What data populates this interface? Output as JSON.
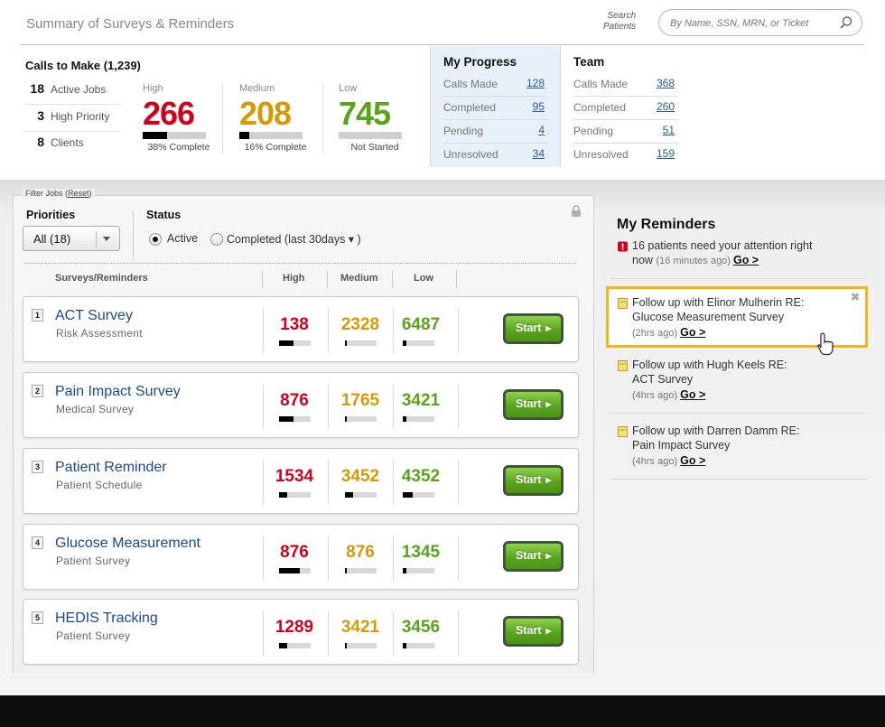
{
  "header": {
    "title": "Summary of Surveys & Reminders",
    "search_label_line1": "Search",
    "search_label_line2": "Patients",
    "search_placeholder": "By Name, SSN, MRN, or Ticket"
  },
  "calls": {
    "title": "Calls to Make (1,239)",
    "stats": [
      {
        "num": "18",
        "label": "Active Jobs"
      },
      {
        "num": "3",
        "label": "High Priority"
      },
      {
        "num": "8",
        "label": "Clients"
      }
    ],
    "high": {
      "label": "High",
      "value": "266",
      "progress": 0.38,
      "caption": "38% Complete"
    },
    "medium": {
      "label": "Medium",
      "value": "208",
      "progress": 0.16,
      "caption": "16% Complete"
    },
    "low": {
      "label": "Low",
      "value": "745",
      "progress": 0.0,
      "caption": "Not Started"
    }
  },
  "my_progress": {
    "title": "My Progress",
    "rows": [
      {
        "label": "Calls Made",
        "value": "128"
      },
      {
        "label": "Completed",
        "value": "95"
      },
      {
        "label": "Pending",
        "value": "4"
      },
      {
        "label": "Unresolved",
        "value": "34"
      }
    ]
  },
  "team": {
    "title": "Team",
    "rows": [
      {
        "label": "Calls Made",
        "value": "368"
      },
      {
        "label": "Completed",
        "value": "260"
      },
      {
        "label": "Pending",
        "value": "51"
      },
      {
        "label": "Unresolved",
        "value": "159"
      }
    ]
  },
  "filter": {
    "legend": "Filter Jobs (",
    "reset": "Reset",
    "legend_end": ")",
    "priorities_label": "Priorities",
    "priorities_value": "All (18)",
    "status_label": "Status",
    "status_active": "Active",
    "status_completed": "Completed (last 30days ▾ )"
  },
  "table": {
    "headers": [
      "Surveys/Reminders",
      "High",
      "Medium",
      "Low"
    ],
    "start_label": "Start",
    "rows": [
      {
        "idx": "1",
        "name": "ACT Survey",
        "sub": "Risk Assessment",
        "high": "138",
        "medium": "2328",
        "low": "6487",
        "high_p": 0.45,
        "medium_p": 0.05,
        "low_p": 0.12
      },
      {
        "idx": "2",
        "name": "Pain Impact Survey",
        "sub": "Medical Survey",
        "high": "876",
        "medium": "1765",
        "low": "3421",
        "high_p": 0.45,
        "medium_p": 0.05,
        "low_p": 0.12
      },
      {
        "idx": "3",
        "name": "Patient Reminder",
        "sub": "Patient Schedule",
        "high": "1534",
        "medium": "3452",
        "low": "4352",
        "high_p": 0.25,
        "medium_p": 0.25,
        "low_p": 0.3
      },
      {
        "idx": "4",
        "name": "Glucose Measurement",
        "sub": "Patient Survey",
        "high": "876",
        "medium": "876",
        "low": "1345",
        "high_p": 0.65,
        "medium_p": 0.05,
        "low_p": 0.12
      },
      {
        "idx": "5",
        "name": "HEDIS Tracking",
        "sub": "Patient Survey",
        "high": "1289",
        "medium": "3421",
        "low": "3456",
        "high_p": 0.25,
        "medium_p": 0.05,
        "low_p": 0.12
      }
    ]
  },
  "reminders": {
    "title": "My Reminders",
    "go_label": "Go >",
    "items": [
      {
        "type": "alert",
        "line1": "16 patients need your attention right",
        "line2": "now",
        "time": "(16 minutes ago)"
      },
      {
        "type": "note",
        "line1": "Follow up with Elinor Mulherin RE:",
        "line2": "Glucose Measurement Survey",
        "time": "(2hrs ago)"
      },
      {
        "type": "note",
        "line1": "Follow up with Hugh Keels RE:",
        "line2": "ACT Survey",
        "time": "(4hrs ago)"
      },
      {
        "type": "note",
        "line1": "Follow up with Darren Damm RE:",
        "line2": "Pain Impact Survey",
        "time": "(4hrs ago)"
      }
    ]
  },
  "colors": {
    "high": "#d0021b",
    "medium": "#d49a07",
    "low": "#5aa31a",
    "link": "#2a5a98",
    "highlight": "#f2b51e",
    "start_button": "#5aa51e"
  }
}
